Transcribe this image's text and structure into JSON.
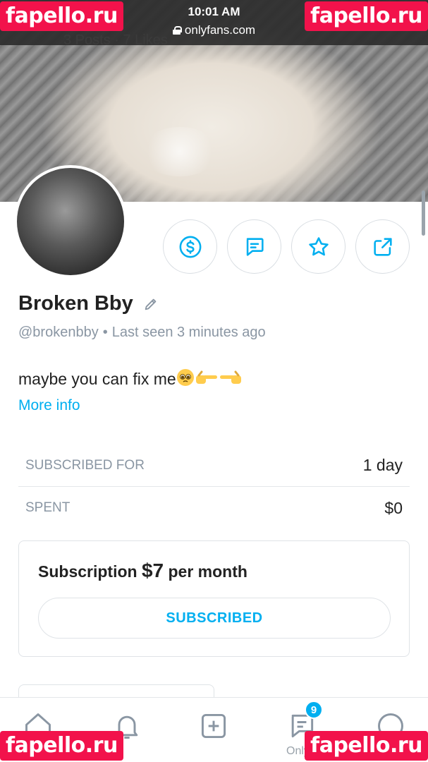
{
  "status_bar": {
    "time": "10:01 AM",
    "url": "onlyfans.com"
  },
  "watermark": {
    "text": "fapello.ru",
    "color": "#f2124b"
  },
  "cover": {
    "counts_text": "3 Posts · 7 Likes"
  },
  "profile": {
    "name": "Broken Bby",
    "handle": "@brokenbby",
    "separator": "•",
    "last_seen": "Last seen 3 minutes ago",
    "bio": "maybe you can fix me",
    "bio_emojis": [
      "pleading-face",
      "pointing-right",
      "pointing-left"
    ],
    "more_info": "More info"
  },
  "actions": [
    {
      "name": "tip-button",
      "icon": "dollar-icon"
    },
    {
      "name": "message-button",
      "icon": "message-icon"
    },
    {
      "name": "favorite-button",
      "icon": "star-icon"
    },
    {
      "name": "share-button",
      "icon": "share-icon"
    }
  ],
  "stats": {
    "subscribed_for_label": "SUBSCRIBED FOR",
    "subscribed_for_value": "1 day",
    "spent_label": "SPENT",
    "spent_value": "$0"
  },
  "subscription": {
    "prefix": "Subscription ",
    "price": "$7",
    "suffix": " per month",
    "button_label": "SUBSCRIBED"
  },
  "bottom_nav": {
    "items": [
      "home-icon",
      "bell-icon",
      "add-icon",
      "messages-icon",
      "profile-icon"
    ],
    "messages_badge": "9",
    "partial_label": "Only"
  },
  "colors": {
    "accent": "#00aff0",
    "muted_text": "#8a96a3",
    "border": "#dfe3e7"
  }
}
